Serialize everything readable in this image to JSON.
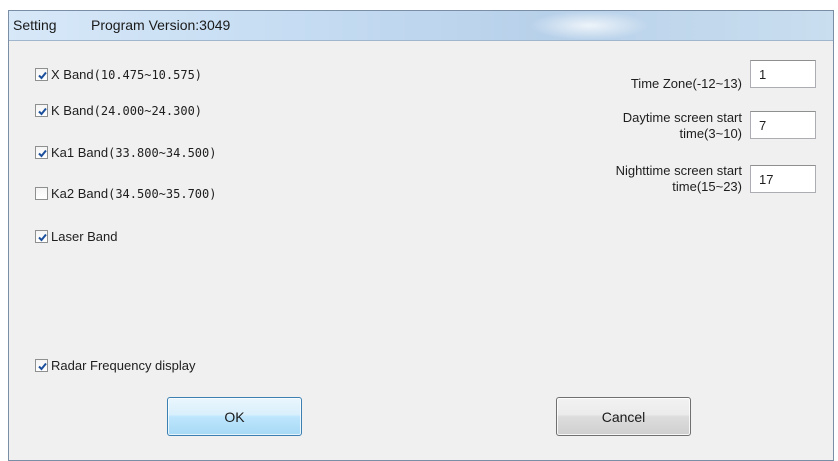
{
  "window": {
    "title": "Setting",
    "version_label": "Program Version:3049"
  },
  "bands": [
    {
      "prefix": "X Band",
      "range": "(10.475~10.575)",
      "checked": true
    },
    {
      "prefix": "K Band",
      "range": "(24.000~24.300)",
      "checked": true
    },
    {
      "prefix": "Ka1 Band",
      "range": "(33.800~34.500)",
      "checked": true
    },
    {
      "prefix": "Ka2 Band",
      "range": "(34.500~35.700)",
      "checked": false
    },
    {
      "prefix": "Laser Band",
      "range": "",
      "checked": true
    }
  ],
  "radar_display": {
    "label": "Radar Frequency display",
    "checked": true
  },
  "settings": {
    "time_zone": {
      "label": "Time Zone(-12~13)",
      "value": "1"
    },
    "daytime": {
      "label_line1": "Daytime screen start",
      "label_line2": "time(3~10)",
      "value": "7"
    },
    "nighttime": {
      "label_line1": "Nighttime screen start",
      "label_line2": "time(15~23)",
      "value": "17"
    }
  },
  "buttons": {
    "ok_label": "OK",
    "cancel_label": "Cancel"
  },
  "colors": {
    "dialog_bg": "#f0f0f0",
    "titlebar": "#c5dcf2",
    "ok_border": "#3c7fb1",
    "checkmark": "#1b4f9c"
  }
}
